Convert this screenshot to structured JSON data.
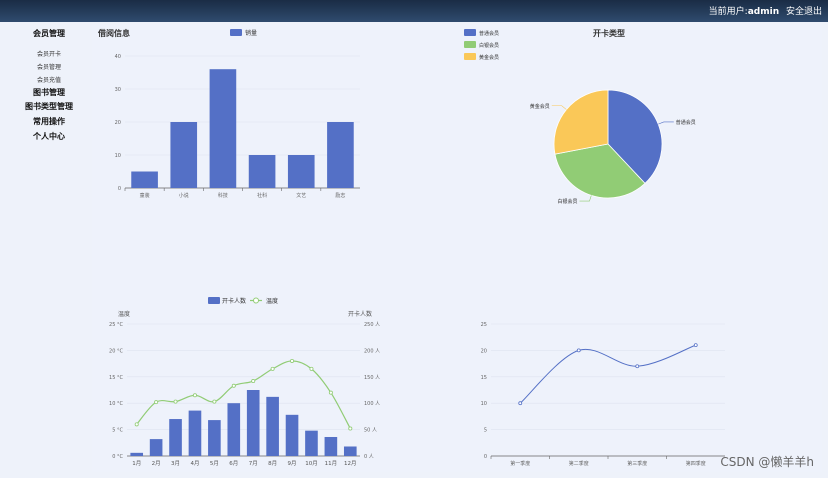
{
  "header": {
    "user_prefix": "当前用户:",
    "username": "admin",
    "logout": "安全退出"
  },
  "sidebar": {
    "groups": [
      {
        "label": "会员管理",
        "items": [
          "会员开卡",
          "会员管理",
          "会员充值"
        ]
      },
      {
        "label": "图书管理",
        "items": []
      },
      {
        "label": "图书类型管理",
        "items": []
      },
      {
        "label": "常用操作",
        "items": []
      },
      {
        "label": "个人中心",
        "items": []
      }
    ]
  },
  "watermark": "CSDN @懒羊羊h",
  "chart_data": [
    {
      "type": "bar",
      "title": "借阅信息",
      "legend": [
        "销量"
      ],
      "legend_position": "top",
      "categories": [
        "童装",
        "小说",
        "科技",
        "社科",
        "文艺",
        "励志"
      ],
      "series": [
        {
          "name": "销量",
          "values": [
            5,
            20,
            36,
            10,
            10,
            20
          ]
        }
      ],
      "ylim": [
        0,
        40
      ],
      "yticks": [
        0,
        10,
        20,
        30,
        40
      ],
      "grid": true,
      "color": "#5470c6"
    },
    {
      "type": "pie",
      "title": "开卡类型",
      "legend": [
        "普通会员",
        "白银会员",
        "黄金会员"
      ],
      "legend_position": "top-left",
      "slices": [
        {
          "name": "普通会员",
          "value": 38
        },
        {
          "name": "白银会员",
          "value": 34
        },
        {
          "name": "黄金会员",
          "value": 28
        }
      ],
      "colors": [
        "#5470c6",
        "#91cc75",
        "#fac858"
      ]
    },
    {
      "type": "bar",
      "legend": [
        "开卡人数",
        "温度"
      ],
      "legend_position": "top",
      "categories": [
        "1月",
        "2月",
        "3月",
        "4月",
        "5月",
        "6月",
        "7月",
        "8月",
        "9月",
        "10月",
        "11月",
        "12月"
      ],
      "series": [
        {
          "name": "开卡人数",
          "type": "bar",
          "axis": "right",
          "values": [
            6,
            32,
            70,
            86,
            68,
            100,
            125,
            112,
            78,
            48,
            36,
            18
          ]
        },
        {
          "name": "温度",
          "type": "line",
          "axis": "left",
          "values": [
            6,
            10.2,
            10.3,
            11.5,
            10.3,
            13.3,
            14.2,
            16.5,
            18,
            16.5,
            12,
            5.2
          ]
        }
      ],
      "ylabel_left": "温度",
      "ylabel_right": "开卡人数",
      "ylim_left": [
        0,
        25
      ],
      "ylim_right": [
        0,
        250
      ],
      "yticks_left": [
        "0 °C",
        "5 °C",
        "10 °C",
        "15 °C",
        "20 °C",
        "25 °C"
      ],
      "yticks_right": [
        "0 人",
        "50 人",
        "100 人",
        "150 人",
        "200 人",
        "250 人"
      ],
      "colors": [
        "#5470c6",
        "#91cc75"
      ]
    },
    {
      "type": "line",
      "categories": [
        "第一季度",
        "第二季度",
        "第三季度",
        "第四季度"
      ],
      "series": [
        {
          "values": [
            10,
            20,
            17,
            21
          ]
        }
      ],
      "ylim": [
        0,
        25
      ],
      "yticks": [
        0,
        5,
        10,
        15,
        20,
        25
      ],
      "smooth": true,
      "color": "#5470c6"
    }
  ]
}
